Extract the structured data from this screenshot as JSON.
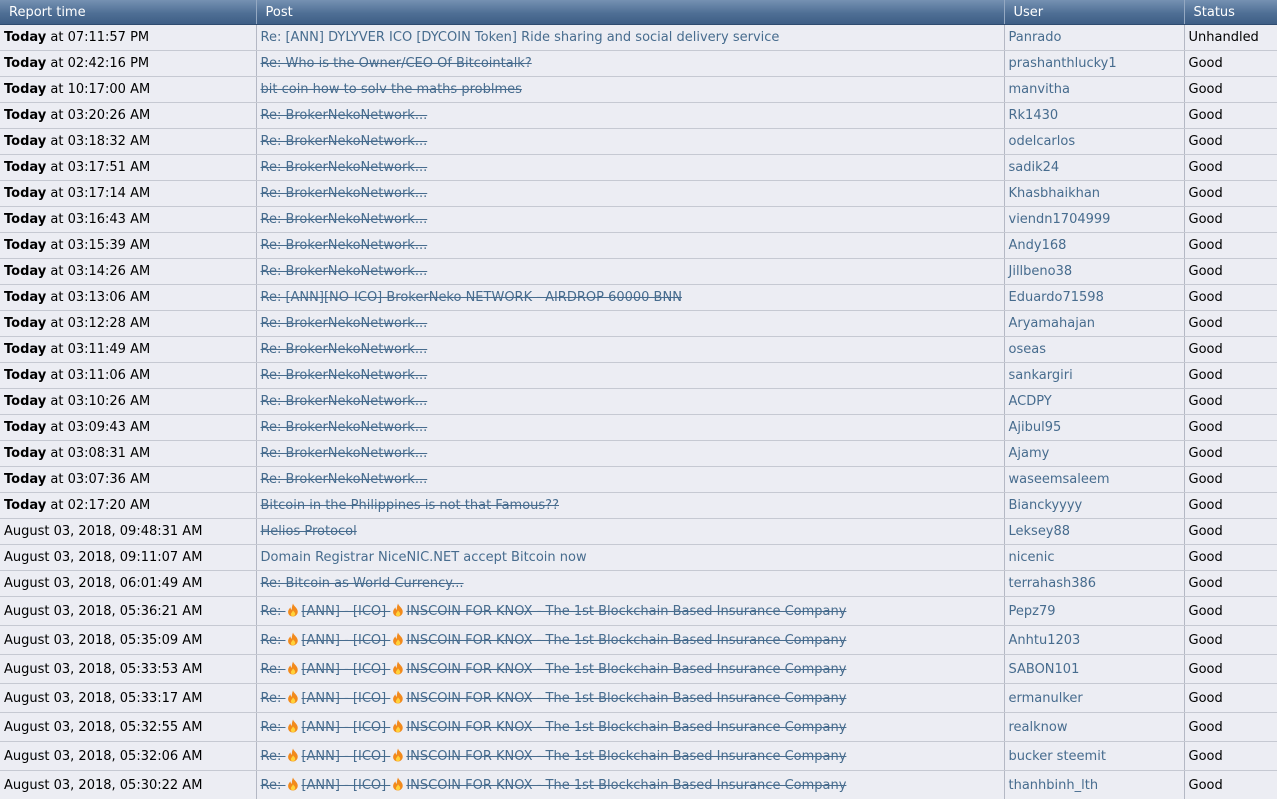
{
  "headers": {
    "time": "Report time",
    "post": "Post",
    "user": "User",
    "status": "Status"
  },
  "colors": {
    "header_top": "#7591b2",
    "header_bottom": "#3e5e85",
    "link": "#476c8e",
    "row_bg": "#ecedf3",
    "fire": "#f28a1c"
  },
  "rows": [
    {
      "day": "Today",
      "time": "at 07:11:57 PM",
      "segments": [
        "Re: [ANN] DYLYVER ICO [DYCOIN Token] Ride sharing and social delivery service"
      ],
      "deleted": false,
      "user": "Panrado",
      "status": "Unhandled"
    },
    {
      "day": "Today",
      "time": "at 02:42:16 PM",
      "segments": [
        "Re: Who is the Owner/CEO Of Bitcointalk?"
      ],
      "deleted": true,
      "user": "prashanthlucky1",
      "status": "Good"
    },
    {
      "day": "Today",
      "time": "at 10:17:00 AM",
      "segments": [
        "bit coin how to solv the maths problmes"
      ],
      "deleted": true,
      "user": "manvitha",
      "status": "Good"
    },
    {
      "day": "Today",
      "time": "at 03:20:26 AM",
      "segments": [
        "Re: BrokerNekoNetwork..."
      ],
      "deleted": true,
      "user": "Rk1430",
      "status": "Good"
    },
    {
      "day": "Today",
      "time": "at 03:18:32 AM",
      "segments": [
        "Re: BrokerNekoNetwork..."
      ],
      "deleted": true,
      "user": "odelcarlos",
      "status": "Good"
    },
    {
      "day": "Today",
      "time": "at 03:17:51 AM",
      "segments": [
        "Re: BrokerNekoNetwork..."
      ],
      "deleted": true,
      "user": "sadik24",
      "status": "Good"
    },
    {
      "day": "Today",
      "time": "at 03:17:14 AM",
      "segments": [
        "Re: BrokerNekoNetwork..."
      ],
      "deleted": true,
      "user": "Khasbhaikhan",
      "status": "Good"
    },
    {
      "day": "Today",
      "time": "at 03:16:43 AM",
      "segments": [
        "Re: BrokerNekoNetwork..."
      ],
      "deleted": true,
      "user": "viendn1704999",
      "status": "Good"
    },
    {
      "day": "Today",
      "time": "at 03:15:39 AM",
      "segments": [
        "Re: BrokerNekoNetwork..."
      ],
      "deleted": true,
      "user": "Andy168",
      "status": "Good"
    },
    {
      "day": "Today",
      "time": "at 03:14:26 AM",
      "segments": [
        "Re: BrokerNekoNetwork..."
      ],
      "deleted": true,
      "user": "Jillbeno38",
      "status": "Good"
    },
    {
      "day": "Today",
      "time": "at 03:13:06 AM",
      "segments": [
        "Re: [ANN][NO-ICO] BrokerNeko NETWORK - AIRDROP 60000 BNN"
      ],
      "deleted": true,
      "user": "Eduardo71598",
      "status": "Good"
    },
    {
      "day": "Today",
      "time": "at 03:12:28 AM",
      "segments": [
        "Re: BrokerNekoNetwork..."
      ],
      "deleted": true,
      "user": "Aryamahajan",
      "status": "Good"
    },
    {
      "day": "Today",
      "time": "at 03:11:49 AM",
      "segments": [
        "Re: BrokerNekoNetwork..."
      ],
      "deleted": true,
      "user": "oseas",
      "status": "Good"
    },
    {
      "day": "Today",
      "time": "at 03:11:06 AM",
      "segments": [
        "Re: BrokerNekoNetwork..."
      ],
      "deleted": true,
      "user": "sankargiri",
      "status": "Good"
    },
    {
      "day": "Today",
      "time": "at 03:10:26 AM",
      "segments": [
        "Re: BrokerNekoNetwork..."
      ],
      "deleted": true,
      "user": "ACDPY",
      "status": "Good"
    },
    {
      "day": "Today",
      "time": "at 03:09:43 AM",
      "segments": [
        "Re: BrokerNekoNetwork..."
      ],
      "deleted": true,
      "user": "Ajibul95",
      "status": "Good"
    },
    {
      "day": "Today",
      "time": "at 03:08:31 AM",
      "segments": [
        "Re: BrokerNekoNetwork..."
      ],
      "deleted": true,
      "user": "Ajamy",
      "status": "Good"
    },
    {
      "day": "Today",
      "time": "at 03:07:36 AM",
      "segments": [
        "Re: BrokerNekoNetwork..."
      ],
      "deleted": true,
      "user": "waseemsaleem",
      "status": "Good"
    },
    {
      "day": "Today",
      "time": "at 02:17:20 AM",
      "segments": [
        "Bitcoin in the Philippines is not that Famous??"
      ],
      "deleted": true,
      "user": "Bianckyyyy",
      "status": "Good"
    },
    {
      "day": "",
      "time": "August 03, 2018, 09:48:31 AM",
      "segments": [
        "Helios Protocol"
      ],
      "deleted": true,
      "user": "Leksey88",
      "status": "Good"
    },
    {
      "day": "",
      "time": "August 03, 2018, 09:11:07 AM",
      "segments": [
        "Domain Registrar NiceNIC.NET accept Bitcoin now"
      ],
      "deleted": false,
      "user": "nicenic",
      "status": "Good"
    },
    {
      "day": "",
      "time": "August 03, 2018, 06:01:49 AM",
      "segments": [
        "Re: Bitcoin as World Currency..."
      ],
      "deleted": true,
      "user": "terrahash386",
      "status": "Good"
    },
    {
      "day": "",
      "time": "August 03, 2018, 05:36:21 AM",
      "segments": [
        "Re: ",
        "[ANN] - [ICO] ",
        "INSCOIN FOR KNOX - The 1st Blockchain Based Insurance Company"
      ],
      "deleted": true,
      "user": "Pepz79",
      "status": "Good"
    },
    {
      "day": "",
      "time": "August 03, 2018, 05:35:09 AM",
      "segments": [
        "Re: ",
        "[ANN] - [ICO] ",
        "INSCOIN FOR KNOX - The 1st Blockchain Based Insurance Company"
      ],
      "deleted": true,
      "user": "Anhtu1203",
      "status": "Good"
    },
    {
      "day": "",
      "time": "August 03, 2018, 05:33:53 AM",
      "segments": [
        "Re: ",
        "[ANN] - [ICO] ",
        "INSCOIN FOR KNOX - The 1st Blockchain Based Insurance Company"
      ],
      "deleted": true,
      "user": "SABON101",
      "status": "Good"
    },
    {
      "day": "",
      "time": "August 03, 2018, 05:33:17 AM",
      "segments": [
        "Re: ",
        "[ANN] - [ICO] ",
        "INSCOIN FOR KNOX - The 1st Blockchain Based Insurance Company"
      ],
      "deleted": true,
      "user": "ermanulker",
      "status": "Good"
    },
    {
      "day": "",
      "time": "August 03, 2018, 05:32:55 AM",
      "segments": [
        "Re: ",
        "[ANN] - [ICO] ",
        "INSCOIN FOR KNOX - The 1st Blockchain Based Insurance Company"
      ],
      "deleted": true,
      "user": "realknow",
      "status": "Good"
    },
    {
      "day": "",
      "time": "August 03, 2018, 05:32:06 AM",
      "segments": [
        "Re: ",
        "[ANN] - [ICO] ",
        "INSCOIN FOR KNOX - The 1st Blockchain Based Insurance Company"
      ],
      "deleted": true,
      "user": "bucker steemit",
      "status": "Good"
    },
    {
      "day": "",
      "time": "August 03, 2018, 05:30:22 AM",
      "segments": [
        "Re: ",
        "[ANN] - [ICO] ",
        "INSCOIN FOR KNOX - The 1st Blockchain Based Insurance Company"
      ],
      "deleted": true,
      "user": "thanhbinh_lth",
      "status": "Good"
    }
  ]
}
